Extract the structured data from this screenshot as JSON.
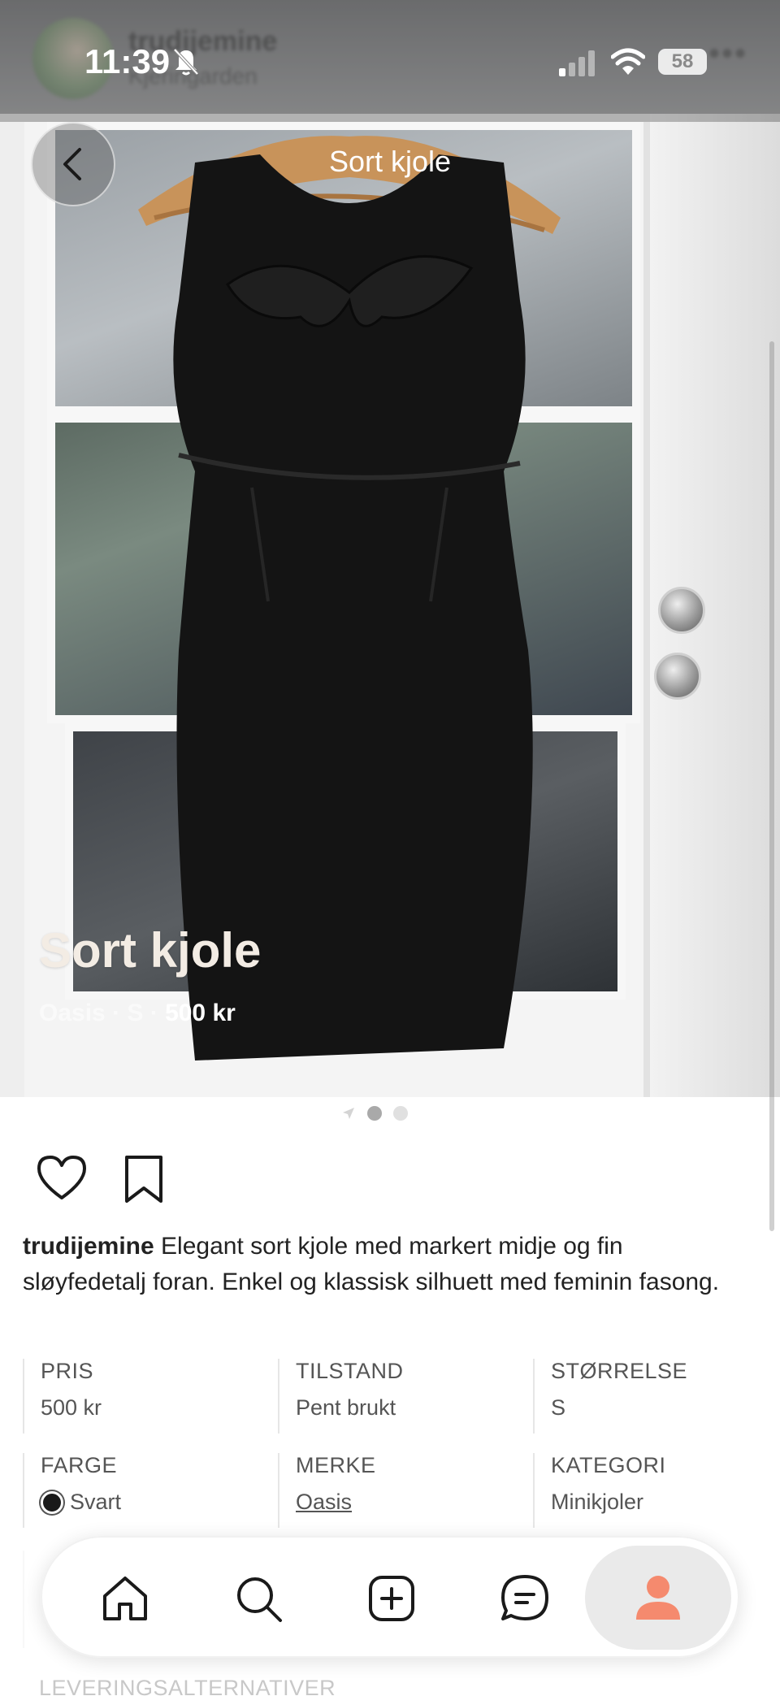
{
  "status_bar": {
    "time": "11:39",
    "battery": "58"
  },
  "blurred_header": {
    "username": "trudijemine",
    "location": "Kjeringarden",
    "more": "•••"
  },
  "nav": {
    "title": "Sort kjole",
    "back_icon": "chevron-left-icon"
  },
  "hero": {
    "title": "Sort kjole",
    "subtitle_faded": "Oasis · S · ",
    "subtitle_price": "500 kr"
  },
  "carousel": {
    "count": 3,
    "active_index": 1
  },
  "post": {
    "username": "trudijemine",
    "text": " Elegant sort kjole med markert midje og fin sløyfedetalj foran. Enkel og klassisk silhuett med feminin fasong."
  },
  "details": {
    "price": {
      "label": "PRIS",
      "value": "500 kr"
    },
    "condition": {
      "label": "TILSTAND",
      "value": "Pent brukt"
    },
    "size": {
      "label": "STØRRELSE",
      "value": "S"
    },
    "color": {
      "label": "FARGE",
      "value": "Svart",
      "swatch": "#1a1a1a"
    },
    "brand": {
      "label": "MERKE",
      "value": "Oasis"
    },
    "category": {
      "label": "KATEGORI",
      "value": "Minikjoler"
    }
  },
  "delivery": {
    "label": "LEVERINGSALTERNATIVER"
  },
  "tabbar": {
    "items": [
      "home-icon",
      "search-icon",
      "add-icon",
      "messages-icon",
      "profile-icon"
    ],
    "active": "profile",
    "accent": "#f58a6e"
  }
}
